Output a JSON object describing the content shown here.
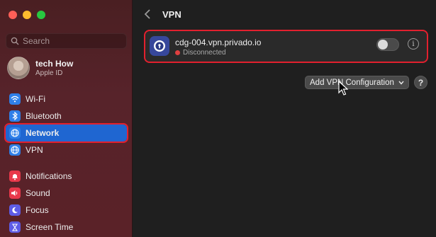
{
  "sidebar": {
    "search_placeholder": "Search",
    "profile": {
      "name": "tech How",
      "subtitle": "Apple ID"
    },
    "group1": [
      {
        "label": "Wi-Fi",
        "icon": "wifi-icon",
        "color": "#2f7fe8"
      },
      {
        "label": "Bluetooth",
        "icon": "bluetooth-icon",
        "color": "#2f7fe8"
      },
      {
        "label": "Network",
        "icon": "globe-icon",
        "color": "#2f7fe8",
        "selected": true
      },
      {
        "label": "VPN",
        "icon": "vpn-globe-icon",
        "color": "#2f7fe8"
      }
    ],
    "group2": [
      {
        "label": "Notifications",
        "icon": "bell-icon",
        "color": "#e8384a"
      },
      {
        "label": "Sound",
        "icon": "speaker-icon",
        "color": "#e8384a"
      },
      {
        "label": "Focus",
        "icon": "moon-icon",
        "color": "#5e5ce6"
      },
      {
        "label": "Screen Time",
        "icon": "hourglass-icon",
        "color": "#5e5ce6"
      }
    ]
  },
  "main": {
    "title": "VPN",
    "vpn": {
      "name": "cdg-004.vpn.privado.io",
      "status": "Disconnected",
      "status_color": "#e04040",
      "enabled": false
    },
    "add_button_label": "Add VPN Configuration",
    "help_label": "?"
  },
  "colors": {
    "accent": "#1f66d1",
    "highlight": "#e2202e"
  }
}
